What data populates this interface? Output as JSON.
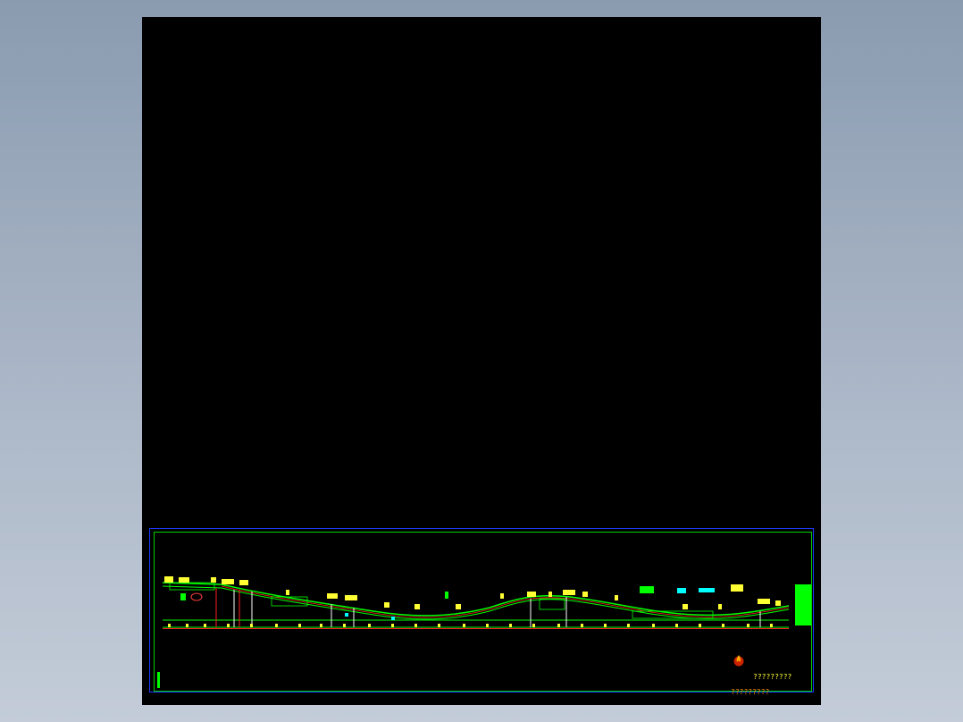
{
  "drawing": {
    "caption_primary": "?????????",
    "caption_secondary": "?????????",
    "colors": {
      "background": "#000000",
      "sheet_border": "#1b3cff",
      "frame_border": "#00d000",
      "profile_line": "#00ff00",
      "annotations": "#ffff33",
      "markers": "#ff2020",
      "accent": "#00ffff"
    },
    "icons": [
      "flame-logo-icon"
    ]
  }
}
